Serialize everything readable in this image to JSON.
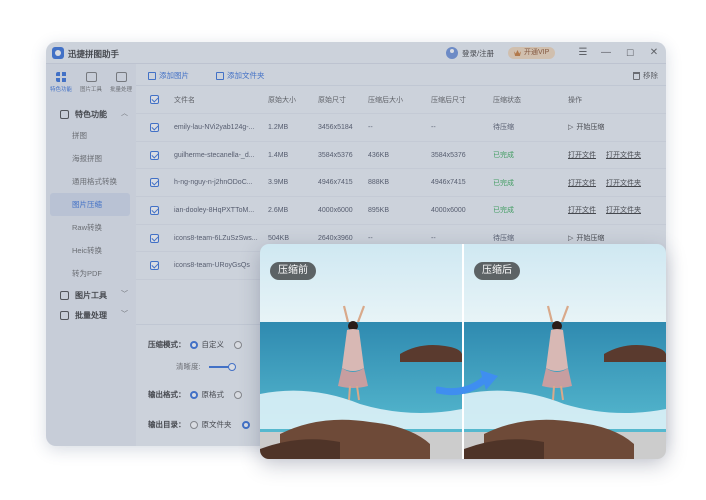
{
  "app": {
    "title": "迅捷拼图助手",
    "login": "登录/注册",
    "vip": "开通VIP",
    "window_buttons": [
      "menu-icon",
      "minimize-icon",
      "maximize-icon",
      "close-icon"
    ]
  },
  "top_nav": [
    {
      "label": "特色功能",
      "icon": "grid-icon",
      "active": true
    },
    {
      "label": "图片工具",
      "icon": "image-tool-icon",
      "active": false
    },
    {
      "label": "批量处理",
      "icon": "batch-icon",
      "active": false
    }
  ],
  "sidebar": {
    "featured": {
      "label": "特色功能",
      "items": [
        "拼图",
        "海报拼图",
        "通用格式转换",
        "图片压缩",
        "Raw转换",
        "Heic转换",
        "转为PDF"
      ],
      "active_item": "图片压缩"
    },
    "image_tools": "图片工具",
    "batch": "批量处理"
  },
  "toolbar": {
    "add_image": "添加图片",
    "add_folder": "添加文件夹",
    "remove": "移除"
  },
  "table": {
    "headers": [
      "文件名",
      "原始大小",
      "原始尺寸",
      "压缩后大小",
      "压缩后尺寸",
      "压缩状态",
      "操作"
    ],
    "rows": [
      {
        "name": "emily-lau-NVi2yab124g-...",
        "size": "1.2MB",
        "dims": "3456x5184",
        "csize": "--",
        "cdims": "--",
        "status": "待压缩",
        "done": false,
        "op1": "开始压缩",
        "op2": ""
      },
      {
        "name": "guilherme-stecanella-_d...",
        "size": "1.4MB",
        "dims": "3584x5376",
        "csize": "436KB",
        "cdims": "3584x5376",
        "status": "已完成",
        "done": true,
        "op1": "打开文件",
        "op2": "打开文件夹"
      },
      {
        "name": "h-ng-nguy-n-j2hnODoC...",
        "size": "3.9MB",
        "dims": "4946x7415",
        "csize": "888KB",
        "cdims": "4946x7415",
        "status": "已完成",
        "done": true,
        "op1": "打开文件",
        "op2": "打开文件夹"
      },
      {
        "name": "ian-dooley-8HqPXTToM...",
        "size": "2.6MB",
        "dims": "4000x6000",
        "csize": "895KB",
        "cdims": "4000x6000",
        "status": "已完成",
        "done": true,
        "op1": "打开文件",
        "op2": "打开文件夹"
      },
      {
        "name": "icons8-team-6LZuSzSws...",
        "size": "504KB",
        "dims": "2640x3960",
        "csize": "--",
        "cdims": "--",
        "status": "待压缩",
        "done": false,
        "op1": "开始压缩",
        "op2": ""
      },
      {
        "name": "icons8-team-URoyGsQs",
        "size": "",
        "dims": "",
        "csize": "",
        "cdims": "",
        "status": "",
        "done": false,
        "op1": "",
        "op2": ""
      }
    ]
  },
  "settings": {
    "mode_label": "压缩模式：",
    "mode_custom": "自定义",
    "clarity_label": "清晰度:",
    "format_label": "输出格式：",
    "format_original": "原格式",
    "dir_label": "输出目录：",
    "dir_original": "原文件夹"
  },
  "compare": {
    "before": "压缩前",
    "after": "压缩后"
  }
}
